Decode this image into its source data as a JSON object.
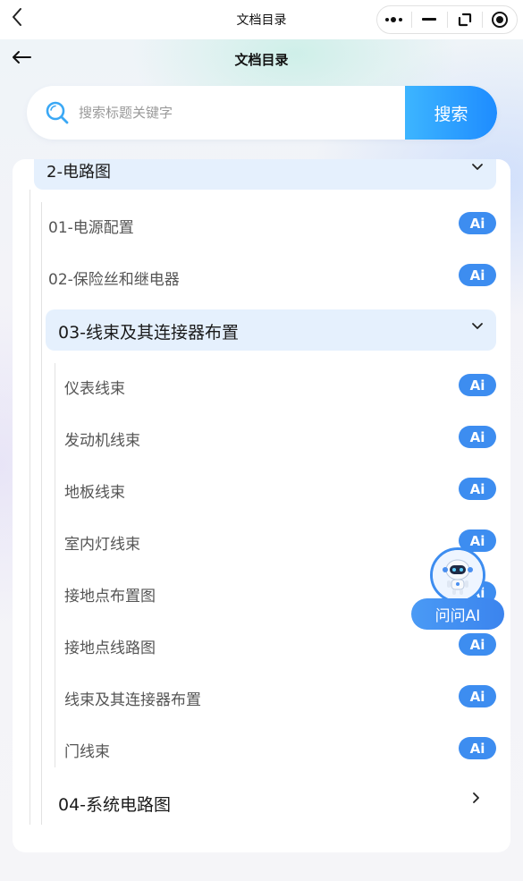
{
  "miniprogram": {
    "title": "文档目录"
  },
  "nav": {
    "title": "文档目录"
  },
  "search": {
    "placeholder": "搜索标题关键字",
    "value": "",
    "button_label": "搜索"
  },
  "tree": {
    "chapter": {
      "label": "2-电路图",
      "expanded": true
    },
    "items_top": [
      {
        "label": "01-电源配置",
        "badge": "Ai"
      },
      {
        "label": "02-保险丝和继电器",
        "badge": "Ai"
      }
    ],
    "section_open": {
      "label": "03-线束及其连接器布置",
      "expanded": true
    },
    "sub_items": [
      {
        "label": "仪表线束",
        "badge": "Ai"
      },
      {
        "label": "发动机线束",
        "badge": "Ai"
      },
      {
        "label": "地板线束",
        "badge": "Ai"
      },
      {
        "label": "室内灯线束",
        "badge": "Ai"
      },
      {
        "label": "接地点布置图",
        "badge": "Ai"
      },
      {
        "label": "接地点线路图",
        "badge": "Ai"
      },
      {
        "label": "线束及其连接器布置",
        "badge": "Ai"
      },
      {
        "label": "门线束",
        "badge": "Ai"
      }
    ],
    "section_closed": {
      "label": "04-系统电路图",
      "expanded": false
    }
  },
  "assistant": {
    "button_label": "问问AI"
  },
  "colors": {
    "accent": "#3d8df0",
    "search_gradient_start": "#3db5ff",
    "search_gradient_end": "#1e8cff",
    "highlight_row": "#e5f0fd"
  }
}
